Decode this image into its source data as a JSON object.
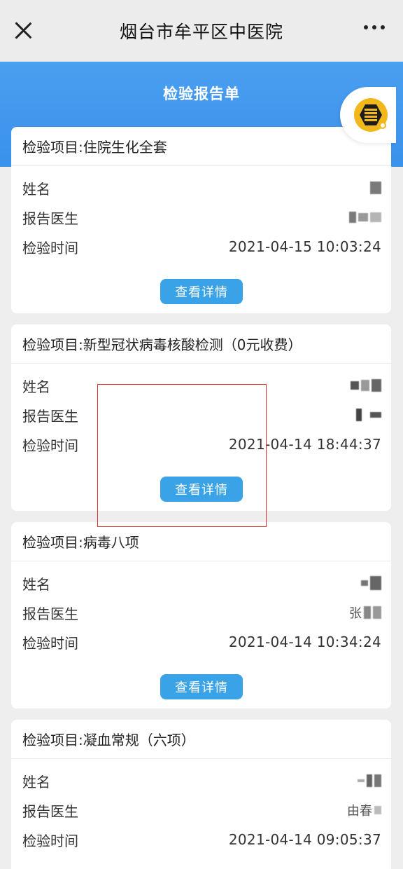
{
  "topbar": {
    "title": "烟台市牟平区中医院",
    "close_icon": "close-icon",
    "more_icon": "more-dots-icon"
  },
  "banner": {
    "title": "检验报告单"
  },
  "float_button": {
    "icon": "hospital-logo-icon"
  },
  "labels": {
    "name": "姓名",
    "doctor": "报告医生",
    "time": "检验时间",
    "detail_button": "查看详情"
  },
  "reports": [
    {
      "item": "检验项目:住院生化全套",
      "time": "2021-04-15 10:03:24"
    },
    {
      "item": "检验项目:新型冠状病毒核酸检测（0元收费）",
      "time": "2021-04-14 18:44:37"
    },
    {
      "item": "检验项目:病毒八项",
      "doctor_partial": "张",
      "time": "2021-04-14 10:34:24"
    },
    {
      "item": "检验项目:凝血常规（六项）",
      "doctor_partial": "由春",
      "time": "2021-04-14 09:05:37"
    }
  ],
  "colors": {
    "banner": "#3a91ea",
    "button": "#3aa3e8",
    "highlight_box": "#d9342b"
  }
}
